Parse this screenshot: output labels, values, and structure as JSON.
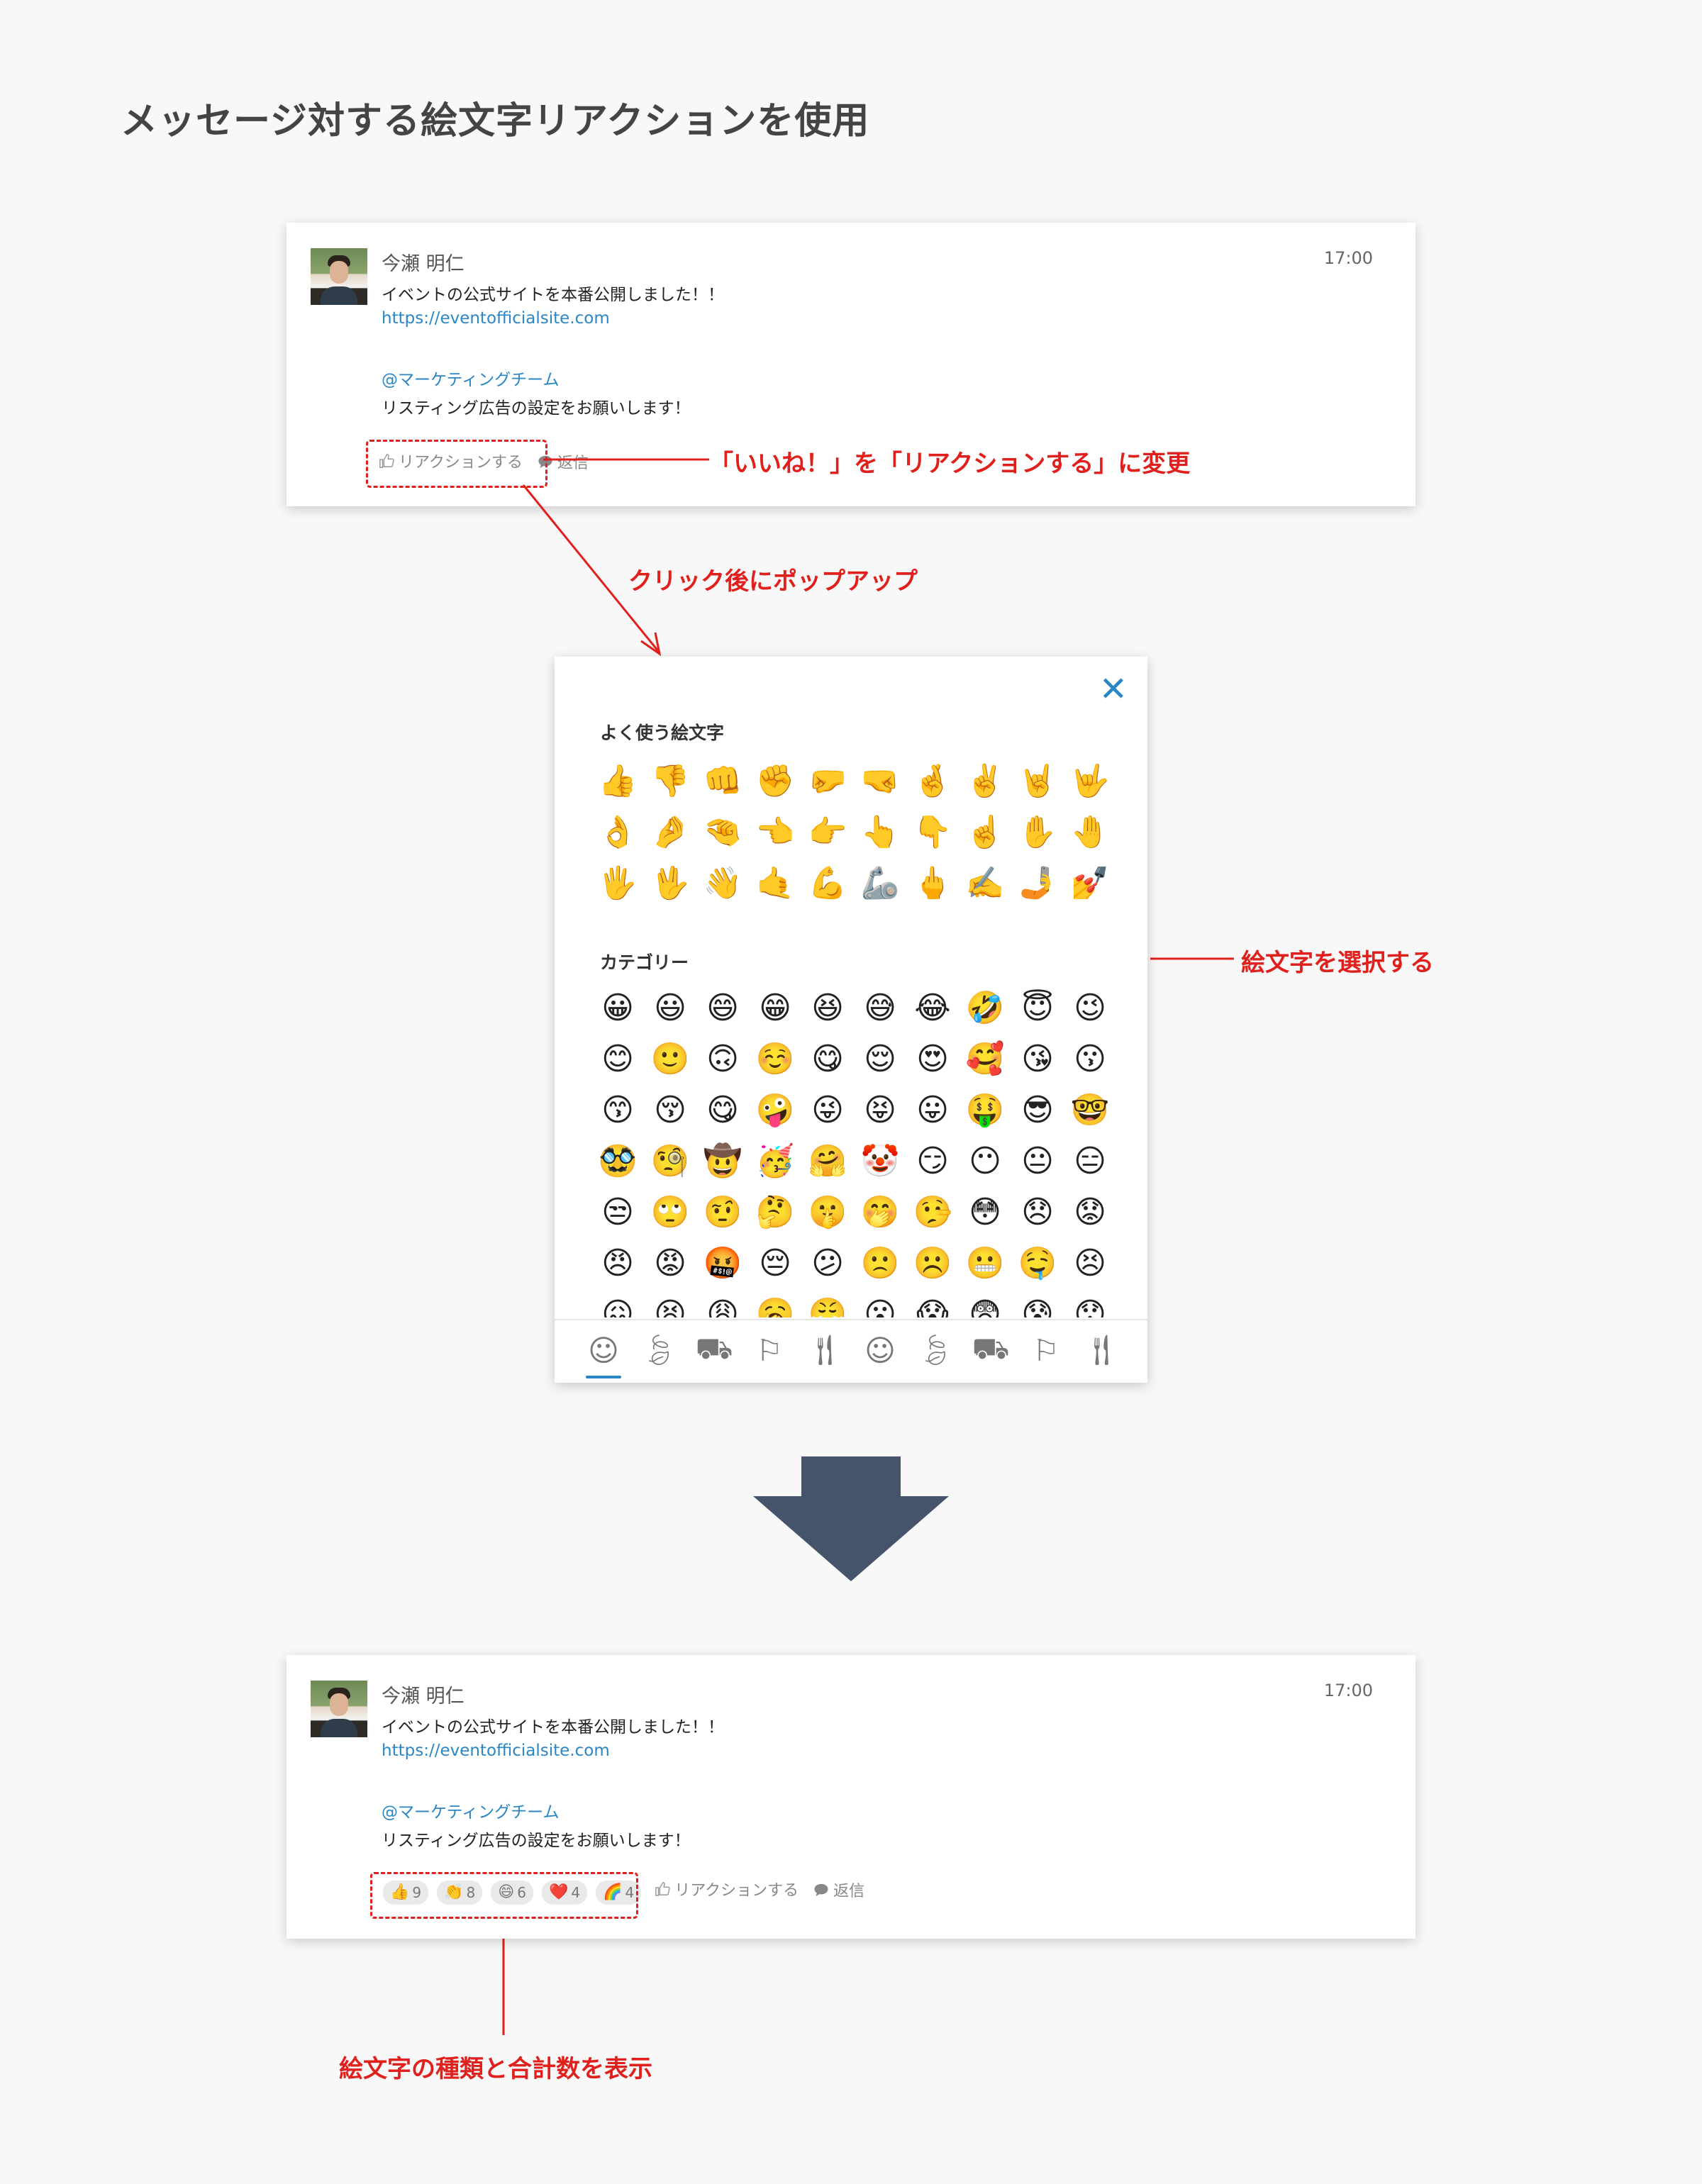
{
  "page": {
    "title": "メッセージ対する絵文字リアクションを使用"
  },
  "message": {
    "sender": "今瀬 明仁",
    "time": "17:00",
    "line1": "イベントの公式サイトを本番公開しました！！",
    "link": "https://eventofficialsite.com",
    "mention": "@マーケティングチーム",
    "line2": "リスティング広告の設定をお願いします！"
  },
  "actions": {
    "react_label": "リアクションする",
    "reply_label": "返信"
  },
  "annotations": {
    "changed_label": "「いいね！」を「リアクションする」に変更",
    "popup_note": "クリック後にポップアップ",
    "select_note": "絵文字を選択する",
    "summary_note": "絵文字の種類と合計数を表示"
  },
  "picker": {
    "frequent_title": "よく使う絵文字",
    "category_title": "カテゴリー",
    "frequent": [
      "👍",
      "👎",
      "👊",
      "✊",
      "🤛",
      "🤜",
      "🤞",
      "✌️",
      "🤘",
      "🤟",
      "👌",
      "🤌",
      "🤏",
      "👈",
      "👉",
      "👆",
      "👇",
      "☝️",
      "✋",
      "🤚",
      "🖐️",
      "🖖",
      "👋",
      "🤙",
      "💪",
      "🦾",
      "🖕",
      "✍️",
      "🤳",
      "💅"
    ],
    "category": [
      "😀",
      "😃",
      "😄",
      "😁",
      "😆",
      "😅",
      "😂",
      "🤣",
      "😇",
      "😉",
      "😊",
      "🙂",
      "🙃",
      "☺️",
      "😋",
      "😌",
      "😍",
      "🥰",
      "😘",
      "😗",
      "😙",
      "😚",
      "😋",
      "🤪",
      "😜",
      "😝",
      "😛",
      "🤑",
      "😎",
      "🤓",
      "🥸",
      "🧐",
      "🤠",
      "🥳",
      "🤗",
      "🤡",
      "😏",
      "😶",
      "😐",
      "😑",
      "😒",
      "🙄",
      "🤨",
      "🤔",
      "🤫",
      "🤭",
      "🤥",
      "😳",
      "😞",
      "😟",
      "😠",
      "😡",
      "🤬",
      "😔",
      "😕",
      "🙁",
      "☹️",
      "😬",
      "🤤",
      "😣",
      "😖",
      "😫",
      "😩",
      "🥱",
      "😤",
      "😮",
      "😱",
      "😨",
      "😰",
      "😯"
    ],
    "tabs": [
      "smiley-tab-icon",
      "leaf-tab-icon",
      "car-tab-icon",
      "flag-tab-icon",
      "food-tab-icon",
      "smiley-tab-icon",
      "leaf-tab-icon",
      "car-tab-icon",
      "flag-tab-icon",
      "food-tab-icon"
    ],
    "close_icon": "close-icon"
  },
  "reactions": [
    {
      "emoji": "👍",
      "count": "9"
    },
    {
      "emoji": "👏",
      "count": "8"
    },
    {
      "emoji": "😄",
      "count": "6"
    },
    {
      "emoji": "❤️",
      "count": "4"
    },
    {
      "emoji": "🌈",
      "count": "4"
    }
  ],
  "colors": {
    "accent": "#2b86c5",
    "annotation": "#e0201c",
    "arrow": "#46546b"
  }
}
